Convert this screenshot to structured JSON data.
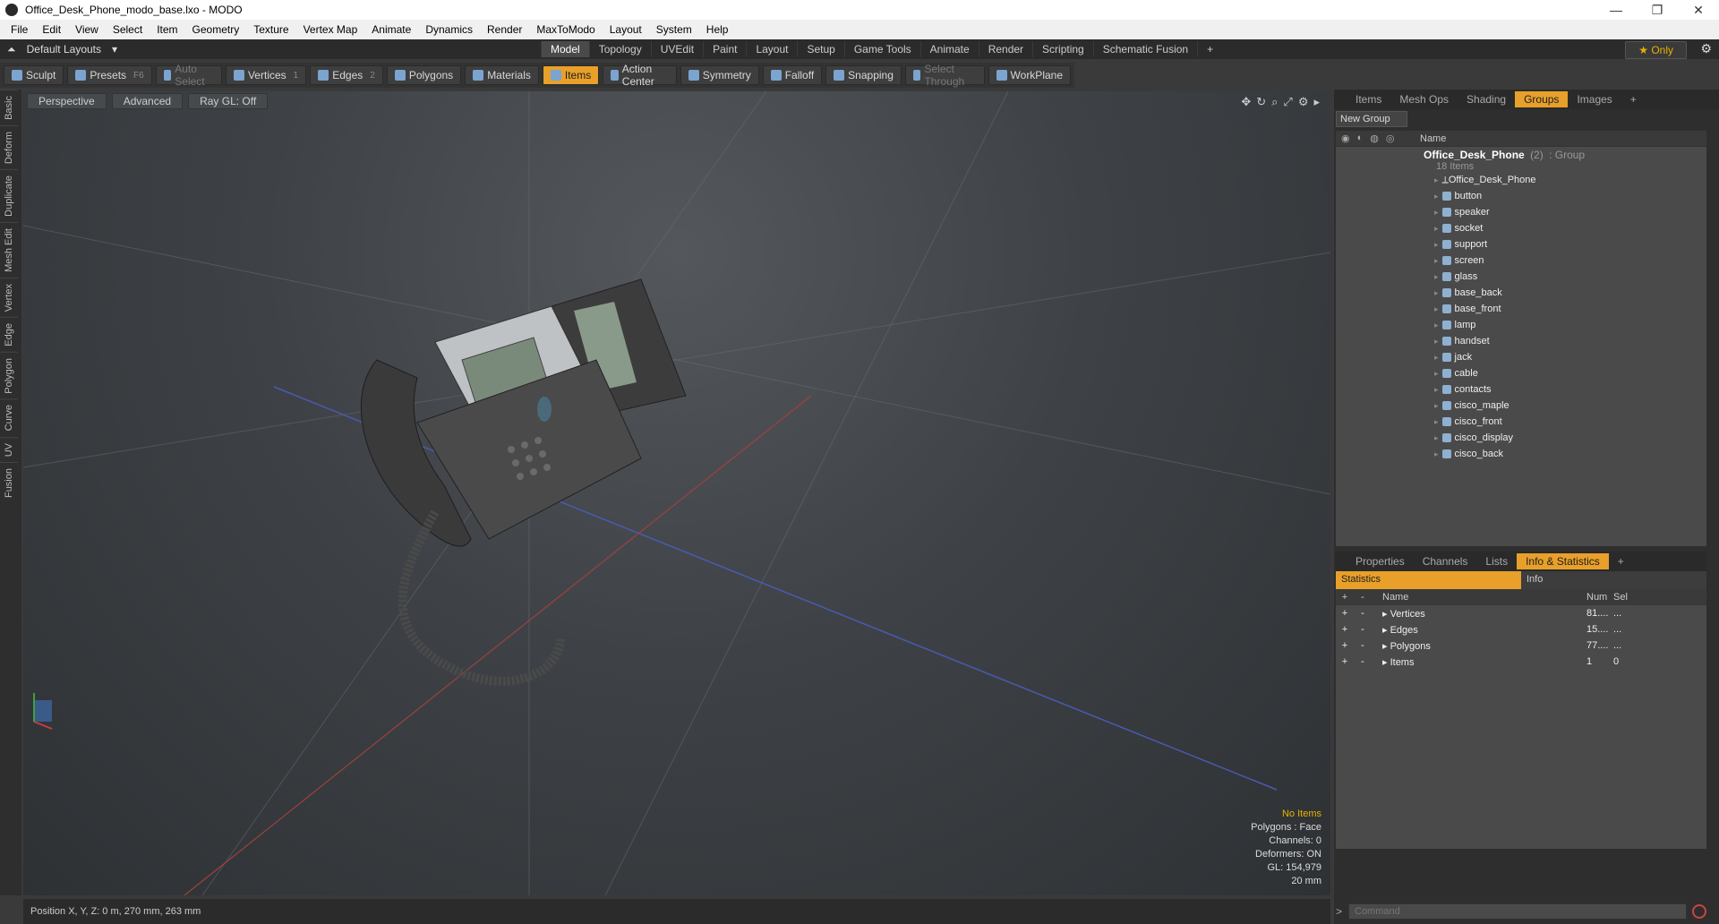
{
  "window": {
    "title": "Office_Desk_Phone_modo_base.lxo - MODO",
    "minimize": "—",
    "maximize": "❐",
    "close": "✕"
  },
  "menu": [
    "File",
    "Edit",
    "View",
    "Select",
    "Item",
    "Geometry",
    "Texture",
    "Vertex Map",
    "Animate",
    "Dynamics",
    "Render",
    "MaxToModo",
    "Layout",
    "System",
    "Help"
  ],
  "layoutbar": {
    "layout_label": "Default Layouts",
    "tabs": [
      "Model",
      "Topology",
      "UVEdit",
      "Paint",
      "Layout",
      "Setup",
      "Game Tools",
      "Animate",
      "Render",
      "Scripting",
      "Schematic Fusion"
    ],
    "active_tab": "Model",
    "only_label": "★ Only"
  },
  "toolbar": {
    "sculpt": "Sculpt",
    "presets": "Presets",
    "presets_key": "F6",
    "auto_select": "Auto Select",
    "vertices": "Vertices",
    "vertices_key": "1",
    "edges": "Edges",
    "edges_key": "2",
    "polygons": "Polygons",
    "materials": "Materials",
    "items": "Items",
    "action_center": "Action Center",
    "symmetry": "Symmetry",
    "falloff": "Falloff",
    "snapping": "Snapping",
    "select_through": "Select Through",
    "workplane": "WorkPlane"
  },
  "left_tabs": [
    "Basic",
    "Deform",
    "Duplicate",
    "Mesh Edit",
    "Vertex",
    "Edge",
    "Polygon",
    "Curve",
    "UV",
    "Fusion"
  ],
  "viewport": {
    "perspective": "Perspective",
    "advanced": "Advanced",
    "raygl": "Ray GL: Off",
    "info": {
      "no_items": "No Items",
      "polygons": "Polygons : Face",
      "channels": "Channels: 0",
      "deformers": "Deformers: ON",
      "gl": "GL: 154,979",
      "scale": "20 mm"
    }
  },
  "status": {
    "position": "Position X, Y, Z:  0 m, 270 mm, 263 mm"
  },
  "right_panel": {
    "tabs": [
      "Items",
      "Mesh Ops",
      "Shading",
      "Groups",
      "Images"
    ],
    "active_tab": "Groups",
    "new_group": "New Group",
    "name_header": "Name",
    "group": {
      "name": "Office_Desk_Phone",
      "count": "(2)",
      "type": ": Group",
      "sub": "18 Items"
    },
    "items": [
      "Office_Desk_Phone",
      "button",
      "speaker",
      "socket",
      "support",
      "screen",
      "glass",
      "base_back",
      "base_front",
      "lamp",
      "handset",
      "jack",
      "cable",
      "contacts",
      "cisco_maple",
      "cisco_front",
      "cisco_display",
      "cisco_back"
    ],
    "bottom_tabs": [
      "Properties",
      "Channels",
      "Lists",
      "Info & Statistics"
    ],
    "bottom_active": "Info & Statistics",
    "sub_tabs": [
      "Statistics",
      "Info"
    ],
    "stats_header": {
      "name": "Name",
      "num": "Num",
      "sel": "Sel"
    },
    "stats": [
      {
        "name": "Vertices",
        "num": "81....",
        "sel": "..."
      },
      {
        "name": "Edges",
        "num": "15....",
        "sel": "..."
      },
      {
        "name": "Polygons",
        "num": "77....",
        "sel": "..."
      },
      {
        "name": "Items",
        "num": "1",
        "sel": "0"
      }
    ],
    "command_placeholder": "Command"
  }
}
